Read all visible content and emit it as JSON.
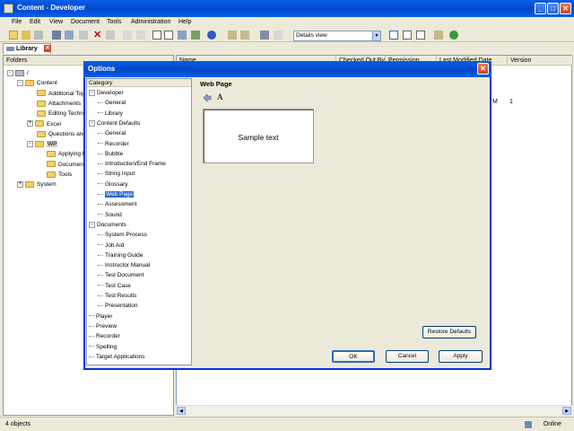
{
  "app": {
    "title": "Content - Developer"
  },
  "menu": [
    "File",
    "Edit",
    "View",
    "Document",
    "Tools",
    "Administration",
    "Help"
  ],
  "toolbar": {
    "view_select": "Details view"
  },
  "tabs": {
    "library": "Library"
  },
  "tree": {
    "header": "Folders",
    "items": [
      {
        "label": "/",
        "indent": 0,
        "exp": "-"
      },
      {
        "label": "Content",
        "indent": 1,
        "exp": "-"
      },
      {
        "label": "Additional Top",
        "indent": 2
      },
      {
        "label": "Attachments",
        "indent": 2
      },
      {
        "label": "Editing Techni",
        "indent": 2
      },
      {
        "label": "Excel",
        "indent": 2,
        "exp": "+"
      },
      {
        "label": "Questions and",
        "indent": 2
      },
      {
        "label": "WP",
        "indent": 2,
        "exp": "-",
        "selected": true
      },
      {
        "label": "Applying F",
        "indent": 3
      },
      {
        "label": "Document",
        "indent": 3
      },
      {
        "label": "Tools",
        "indent": 3
      },
      {
        "label": "System",
        "indent": 1,
        "exp": "+"
      }
    ]
  },
  "list": {
    "columns": [
      "Name",
      "Checked Out By",
      "Permission",
      "Last Modified Date",
      "Version"
    ],
    "partial_cells": [
      "M",
      "1"
    ]
  },
  "dialog": {
    "title": "Options",
    "category_header": "Category",
    "categories": [
      {
        "label": "Developer",
        "level": 0,
        "exp": "-"
      },
      {
        "label": "General",
        "level": 1
      },
      {
        "label": "Library",
        "level": 1
      },
      {
        "label": "Content Defaults",
        "level": 0,
        "exp": "-"
      },
      {
        "label": "General",
        "level": 1
      },
      {
        "label": "Recorder",
        "level": 1
      },
      {
        "label": "Bubble",
        "level": 1
      },
      {
        "label": "Introduction/End Frame",
        "level": 1
      },
      {
        "label": "String Input",
        "level": 1
      },
      {
        "label": "Glossary",
        "level": 1
      },
      {
        "label": "Web Page",
        "level": 1,
        "selected": true
      },
      {
        "label": "Assessment",
        "level": 1
      },
      {
        "label": "Sound",
        "level": 1
      },
      {
        "label": "Documents",
        "level": 0,
        "exp": "-"
      },
      {
        "label": "System Process",
        "level": 1
      },
      {
        "label": "Job Aid",
        "level": 1
      },
      {
        "label": "Training Guide",
        "level": 1
      },
      {
        "label": "Instructor Manual",
        "level": 1
      },
      {
        "label": "Test Document",
        "level": 1
      },
      {
        "label": "Test Case",
        "level": 1
      },
      {
        "label": "Test Results",
        "level": 1
      },
      {
        "label": "Presentation",
        "level": 1
      },
      {
        "label": "Player",
        "level": 0
      },
      {
        "label": "Preview",
        "level": 0
      },
      {
        "label": "Recorder",
        "level": 0
      },
      {
        "label": "Spelling",
        "level": 0
      },
      {
        "label": "Target Applications",
        "level": 0
      }
    ],
    "page_title": "Web Page",
    "font_icon_label": "A",
    "sample_text": "Sample text",
    "restore_label": "Restore Defaults",
    "ok_label": "OK",
    "cancel_label": "Cancel",
    "apply_label": "Apply"
  },
  "status": {
    "objects": "4 objects",
    "online": "Online"
  }
}
